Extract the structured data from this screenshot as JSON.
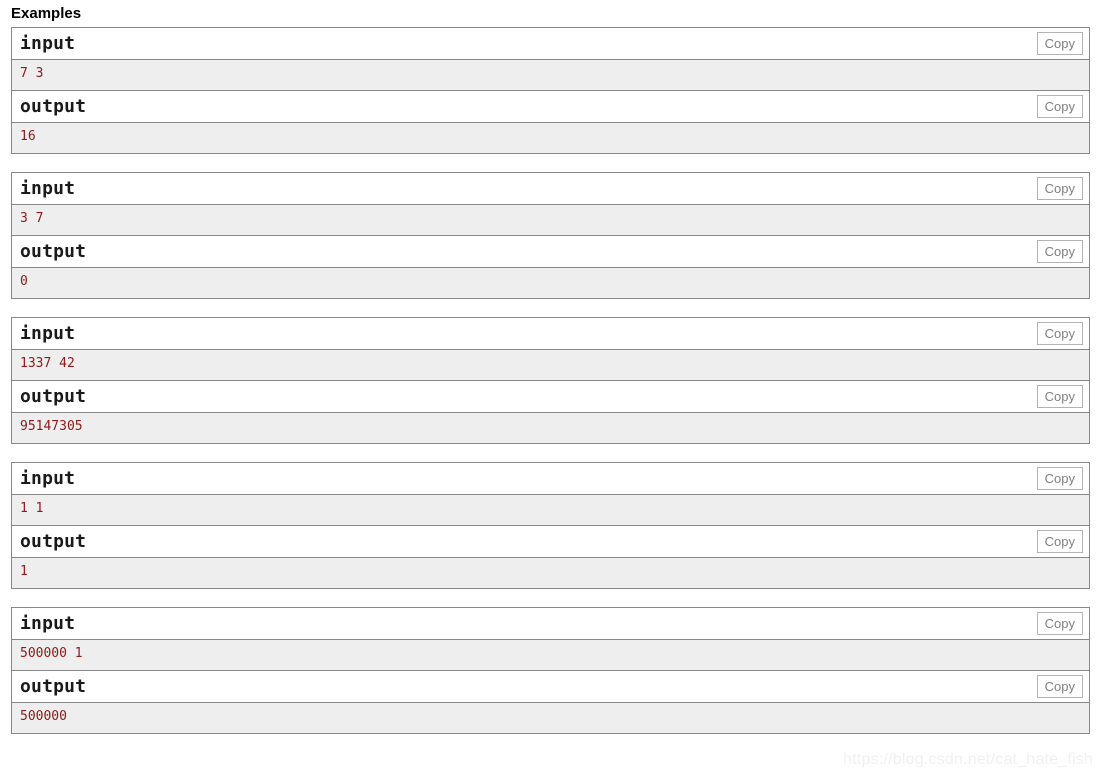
{
  "section": {
    "title": "Examples"
  },
  "labels": {
    "input": "input",
    "output": "output",
    "copy": "Copy"
  },
  "colors": {
    "border": "#888888",
    "pre_background": "#eeeeee",
    "value_text": "#8b1a1a",
    "copy_button_text": "#808080",
    "copy_button_border": "#b3b3b3",
    "page_background": "#ffffff",
    "watermark_text": "#f0f0f0"
  },
  "examples": [
    {
      "input_label": "input",
      "input_value": "7 3",
      "output_label": "output",
      "output_value": "16",
      "copy_input_label": "Copy",
      "copy_output_label": "Copy"
    },
    {
      "input_label": "input",
      "input_value": "3 7",
      "output_label": "output",
      "output_value": "0",
      "copy_input_label": "Copy",
      "copy_output_label": "Copy"
    },
    {
      "input_label": "input",
      "input_value": "1337 42",
      "output_label": "output",
      "output_value": "95147305",
      "copy_input_label": "Copy",
      "copy_output_label": "Copy"
    },
    {
      "input_label": "input",
      "input_value": "1 1",
      "output_label": "output",
      "output_value": "1",
      "copy_input_label": "Copy",
      "copy_output_label": "Copy"
    },
    {
      "input_label": "input",
      "input_value": "500000 1",
      "output_label": "output",
      "output_value": "500000",
      "copy_input_label": "Copy",
      "copy_output_label": "Copy"
    }
  ],
  "watermark": {
    "text": "https://blog.csdn.net/cat_hate_fish"
  }
}
